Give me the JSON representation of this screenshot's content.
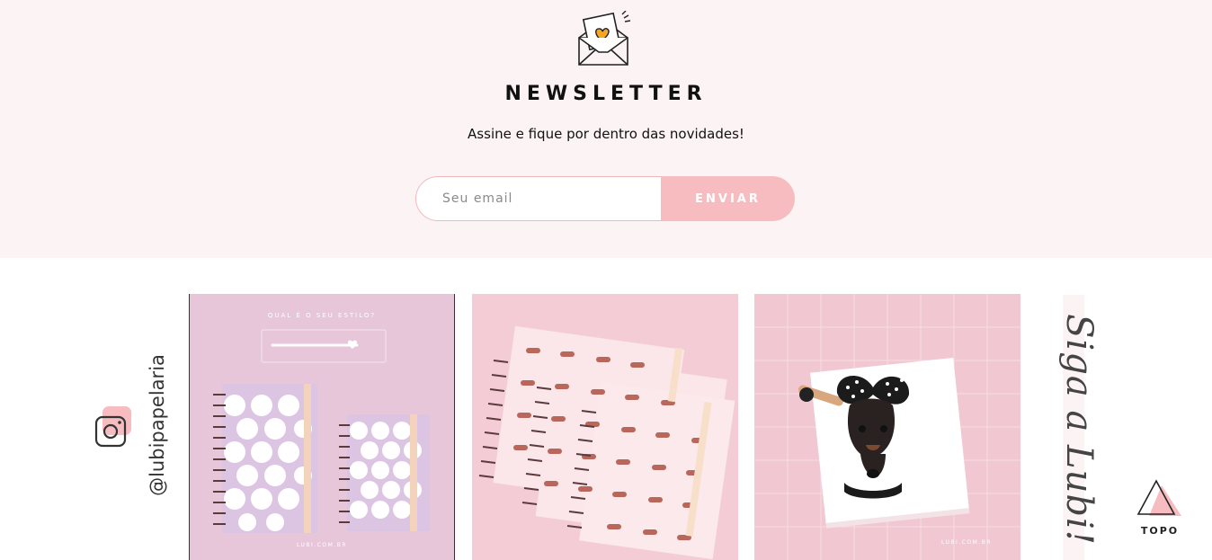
{
  "newsletter": {
    "icon": "envelope-heart-icon",
    "title": "NEWSLETTER",
    "subtitle": "Assine e fique por dentro das novidades!",
    "email_placeholder": "Seu email",
    "email_value": "",
    "submit_label": "ENVIAR",
    "colors": {
      "background": "#fcf4f4",
      "accent": "#f6bcc0",
      "border": "#f1b8bc"
    }
  },
  "instagram": {
    "icon": "instagram-icon",
    "handle": "@lubipapelaria",
    "photos": [
      {
        "name": "photo-polka-dot-notebooks",
        "caption_top": "QUAL É O SEU ESTILO?",
        "watermark": "LUBI.COM.BR"
      },
      {
        "name": "photo-dachshund-notebooks"
      },
      {
        "name": "photo-dog-notebook",
        "watermark": "LUBI.COM.BR"
      }
    ],
    "follow_text": "Siga a Lubi!"
  },
  "back_to_top": {
    "icon": "triangle-up-icon",
    "label": "TOPO"
  }
}
